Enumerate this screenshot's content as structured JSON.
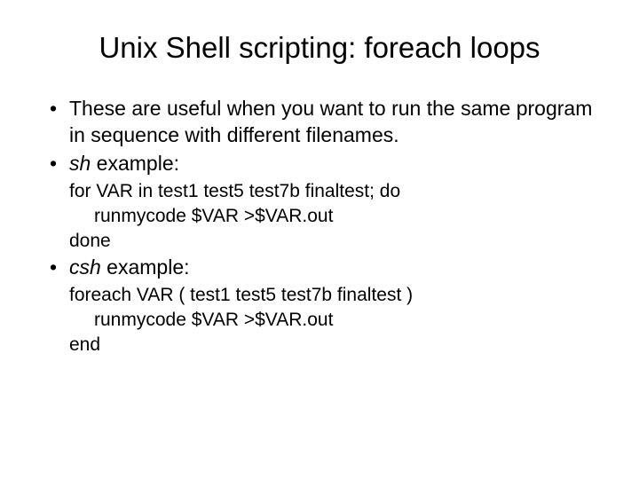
{
  "title": "Unix Shell scripting: foreach loops",
  "bullets": {
    "intro": "These are useful when you want to run the same program in sequence with different filenames.",
    "sh_label_prefix": "sh",
    "sh_label_suffix": " example:",
    "csh_label_prefix": "csh",
    "csh_label_suffix": " example:"
  },
  "sh_code": {
    "line1": "for VAR in test1 test5 test7b finaltest; do",
    "line2": "runmycode $VAR >$VAR.out",
    "line3": "done"
  },
  "csh_code": {
    "line1": "foreach VAR ( test1 test5 test7b finaltest )",
    "line2": "runmycode $VAR >$VAR.out",
    "line3": "end"
  }
}
